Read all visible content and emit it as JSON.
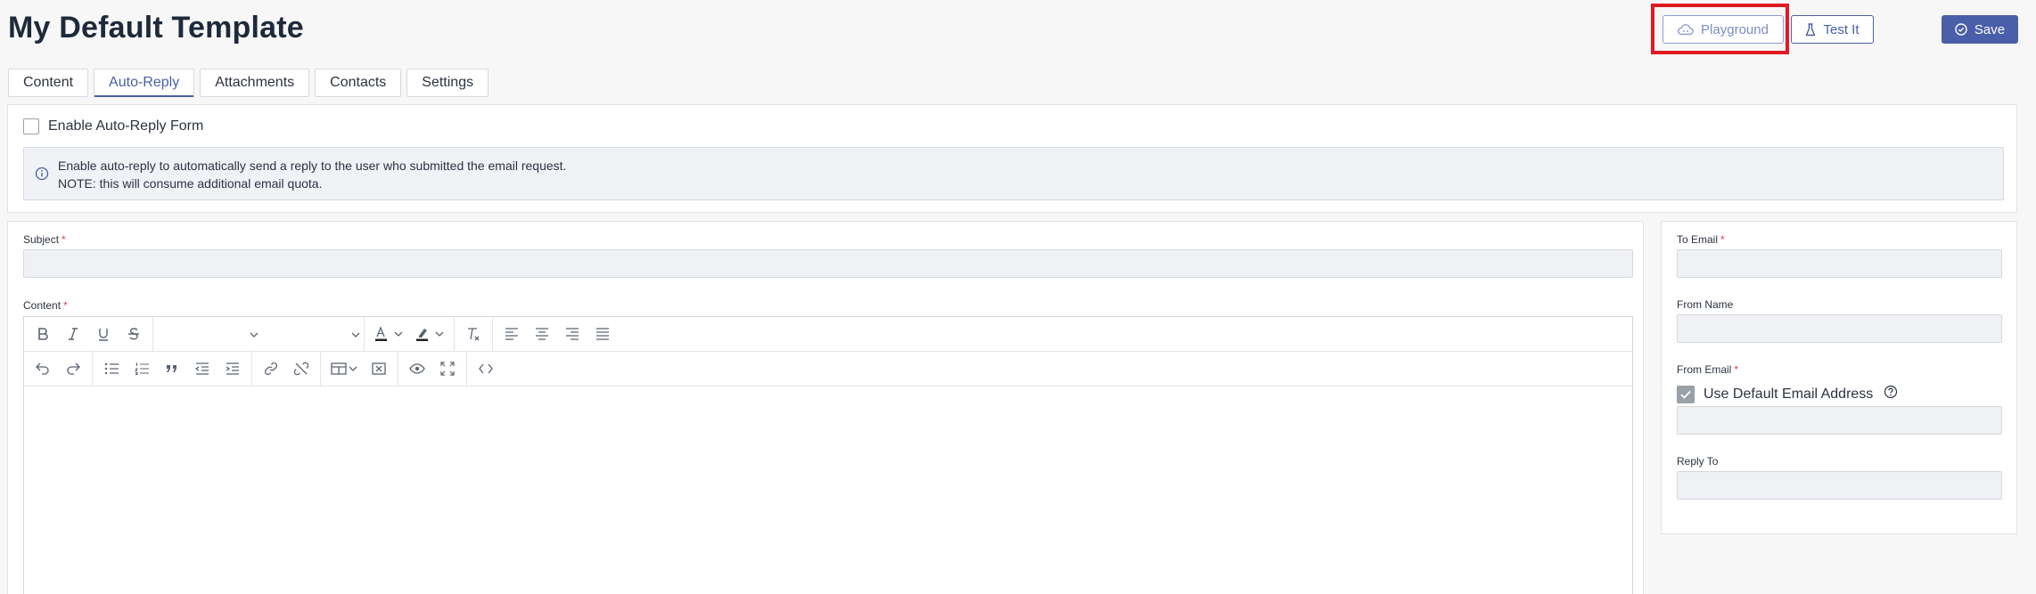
{
  "header": {
    "title": "My Default Template",
    "playground_label": "Playground",
    "test_label": "Test It",
    "save_label": "Save"
  },
  "tabs": [
    {
      "label": "Content",
      "active": false
    },
    {
      "label": "Auto-Reply",
      "active": true
    },
    {
      "label": "Attachments",
      "active": false
    },
    {
      "label": "Contacts",
      "active": false
    },
    {
      "label": "Settings",
      "active": false
    }
  ],
  "autoreply": {
    "enable_label": "Enable Auto-Reply Form",
    "enable_checked": false,
    "info_line1": "Enable auto-reply to automatically send a reply to the user who submitted the email request.",
    "info_line2": "NOTE: this will consume additional email quota."
  },
  "form": {
    "subject_label": "Subject",
    "subject_value": "",
    "content_label": "Content",
    "content_value": "",
    "required_mark": "*"
  },
  "side_form": {
    "to_email_label": "To Email",
    "from_name_label": "From Name",
    "from_email_label": "From Email",
    "use_default_label": "Use Default Email Address",
    "use_default_checked": true,
    "reply_to_label": "Reply To"
  },
  "toolbar": {
    "row1": [
      "bold-icon",
      "italic-icon",
      "underline-icon",
      "strikethrough-icon",
      "block-format-select",
      "font-size-select",
      "text-color-icon",
      "highlight-color-icon",
      "clear-format-icon",
      "align-left-icon",
      "align-center-icon",
      "align-right-icon",
      "align-justify-icon"
    ],
    "row2": [
      "undo-icon",
      "redo-icon",
      "bullet-list-icon",
      "numbered-list-icon",
      "blockquote-icon",
      "outdent-icon",
      "indent-icon",
      "link-icon",
      "unlink-icon",
      "table-icon",
      "remove-table-icon",
      "preview-icon",
      "fullscreen-icon",
      "source-code-icon"
    ]
  },
  "colors": {
    "accent": "#4a5fa9",
    "highlight_box": "#e11b22",
    "required": "#e0414a",
    "input_bg": "#f0f1f4"
  }
}
